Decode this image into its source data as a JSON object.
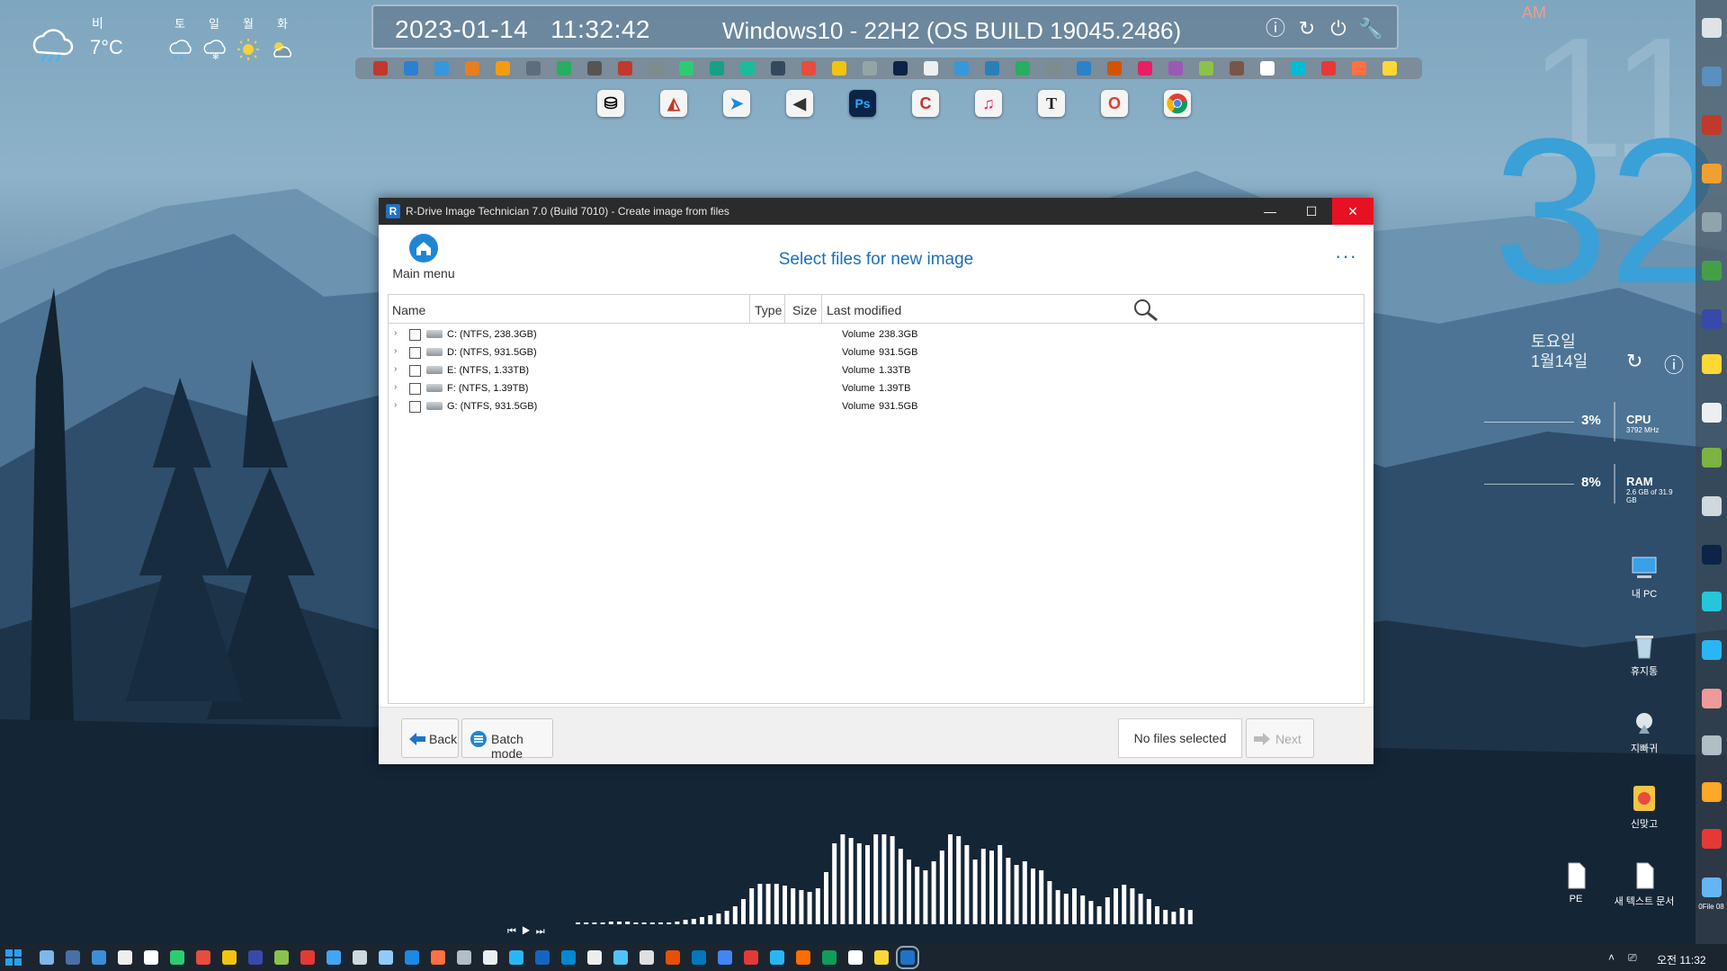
{
  "weather": {
    "current": {
      "condition": "비",
      "temp": "7°C",
      "icon": "rain-cloud-icon"
    },
    "forecast": [
      {
        "day": "토",
        "icon": "rain-cloud-icon"
      },
      {
        "day": "일",
        "icon": "snow-cloud-icon"
      },
      {
        "day": "월",
        "icon": "sun-icon"
      },
      {
        "day": "화",
        "icon": "partly-cloudy-icon"
      }
    ]
  },
  "clockbar": {
    "date": "2023-01-14",
    "time": "11:32:42",
    "os": "Windows10 - 22H2 (OS BUILD 19045.2486)",
    "controls": [
      "info-icon",
      "refresh-icon",
      "power-icon",
      "wrench-icon"
    ]
  },
  "bigclock": {
    "ampm": "AM",
    "hour": "11",
    "minute": "32",
    "weekday": "토요일",
    "date": "1월14일"
  },
  "meters": {
    "cpu": {
      "percent": "3%",
      "label": "CPU",
      "detail": "3792 MHz"
    },
    "ram": {
      "percent": "8%",
      "label": "RAM",
      "detail": "2.6 GB of 31.9 GB"
    }
  },
  "desktop_icons": [
    {
      "label": "내 PC",
      "icon": "computer-icon"
    },
    {
      "label": "휴지통",
      "icon": "recycle-bin-icon"
    },
    {
      "label": "지빠귀",
      "icon": "bird-app-icon"
    },
    {
      "label": "신맞고",
      "icon": "card-game-icon"
    },
    {
      "label": "PE",
      "icon": "text-file-icon"
    },
    {
      "label": "새 텍스트 문서",
      "icon": "text-file-icon"
    },
    {
      "label": "0File 08",
      "icon": "app-icon"
    }
  ],
  "dock": [
    "disk-icon",
    "pie-icon",
    "arrow-app-icon",
    "paper-plane-icon",
    "photoshop-icon",
    "ccleaner-icon",
    "music-icon",
    "T",
    "opera-icon",
    "chrome-icon"
  ],
  "window": {
    "title": "R-Drive Image Technician 7.0 (Build 7010) - Create image from files",
    "app_icon_letter": "R",
    "controls": {
      "minimize": "—",
      "maximize": "☐",
      "close": "✕"
    },
    "home_label": "Main menu",
    "page_title": "Select files for new image",
    "more": "···",
    "columns": {
      "name": "Name",
      "type": "Type",
      "size": "Size",
      "modified": "Last modified"
    },
    "drives": [
      {
        "name": "C: (NTFS, 238.3GB)",
        "type": "Volume",
        "size": "238.3GB"
      },
      {
        "name": "D: (NTFS, 931.5GB)",
        "type": "Volume",
        "size": "931.5GB"
      },
      {
        "name": "E: (NTFS, 1.33TB)",
        "type": "Volume",
        "size": "1.33TB"
      },
      {
        "name": "F: (NTFS, 1.39TB)",
        "type": "Volume",
        "size": "1.39TB"
      },
      {
        "name": "G: (NTFS, 931.5GB)",
        "type": "Volume",
        "size": "931.5GB"
      }
    ],
    "footer": {
      "back": "Back",
      "batch": "Batch mode",
      "status": "No files selected",
      "next": "Next"
    }
  },
  "taskbar": {
    "clock": "오전 11:32"
  }
}
